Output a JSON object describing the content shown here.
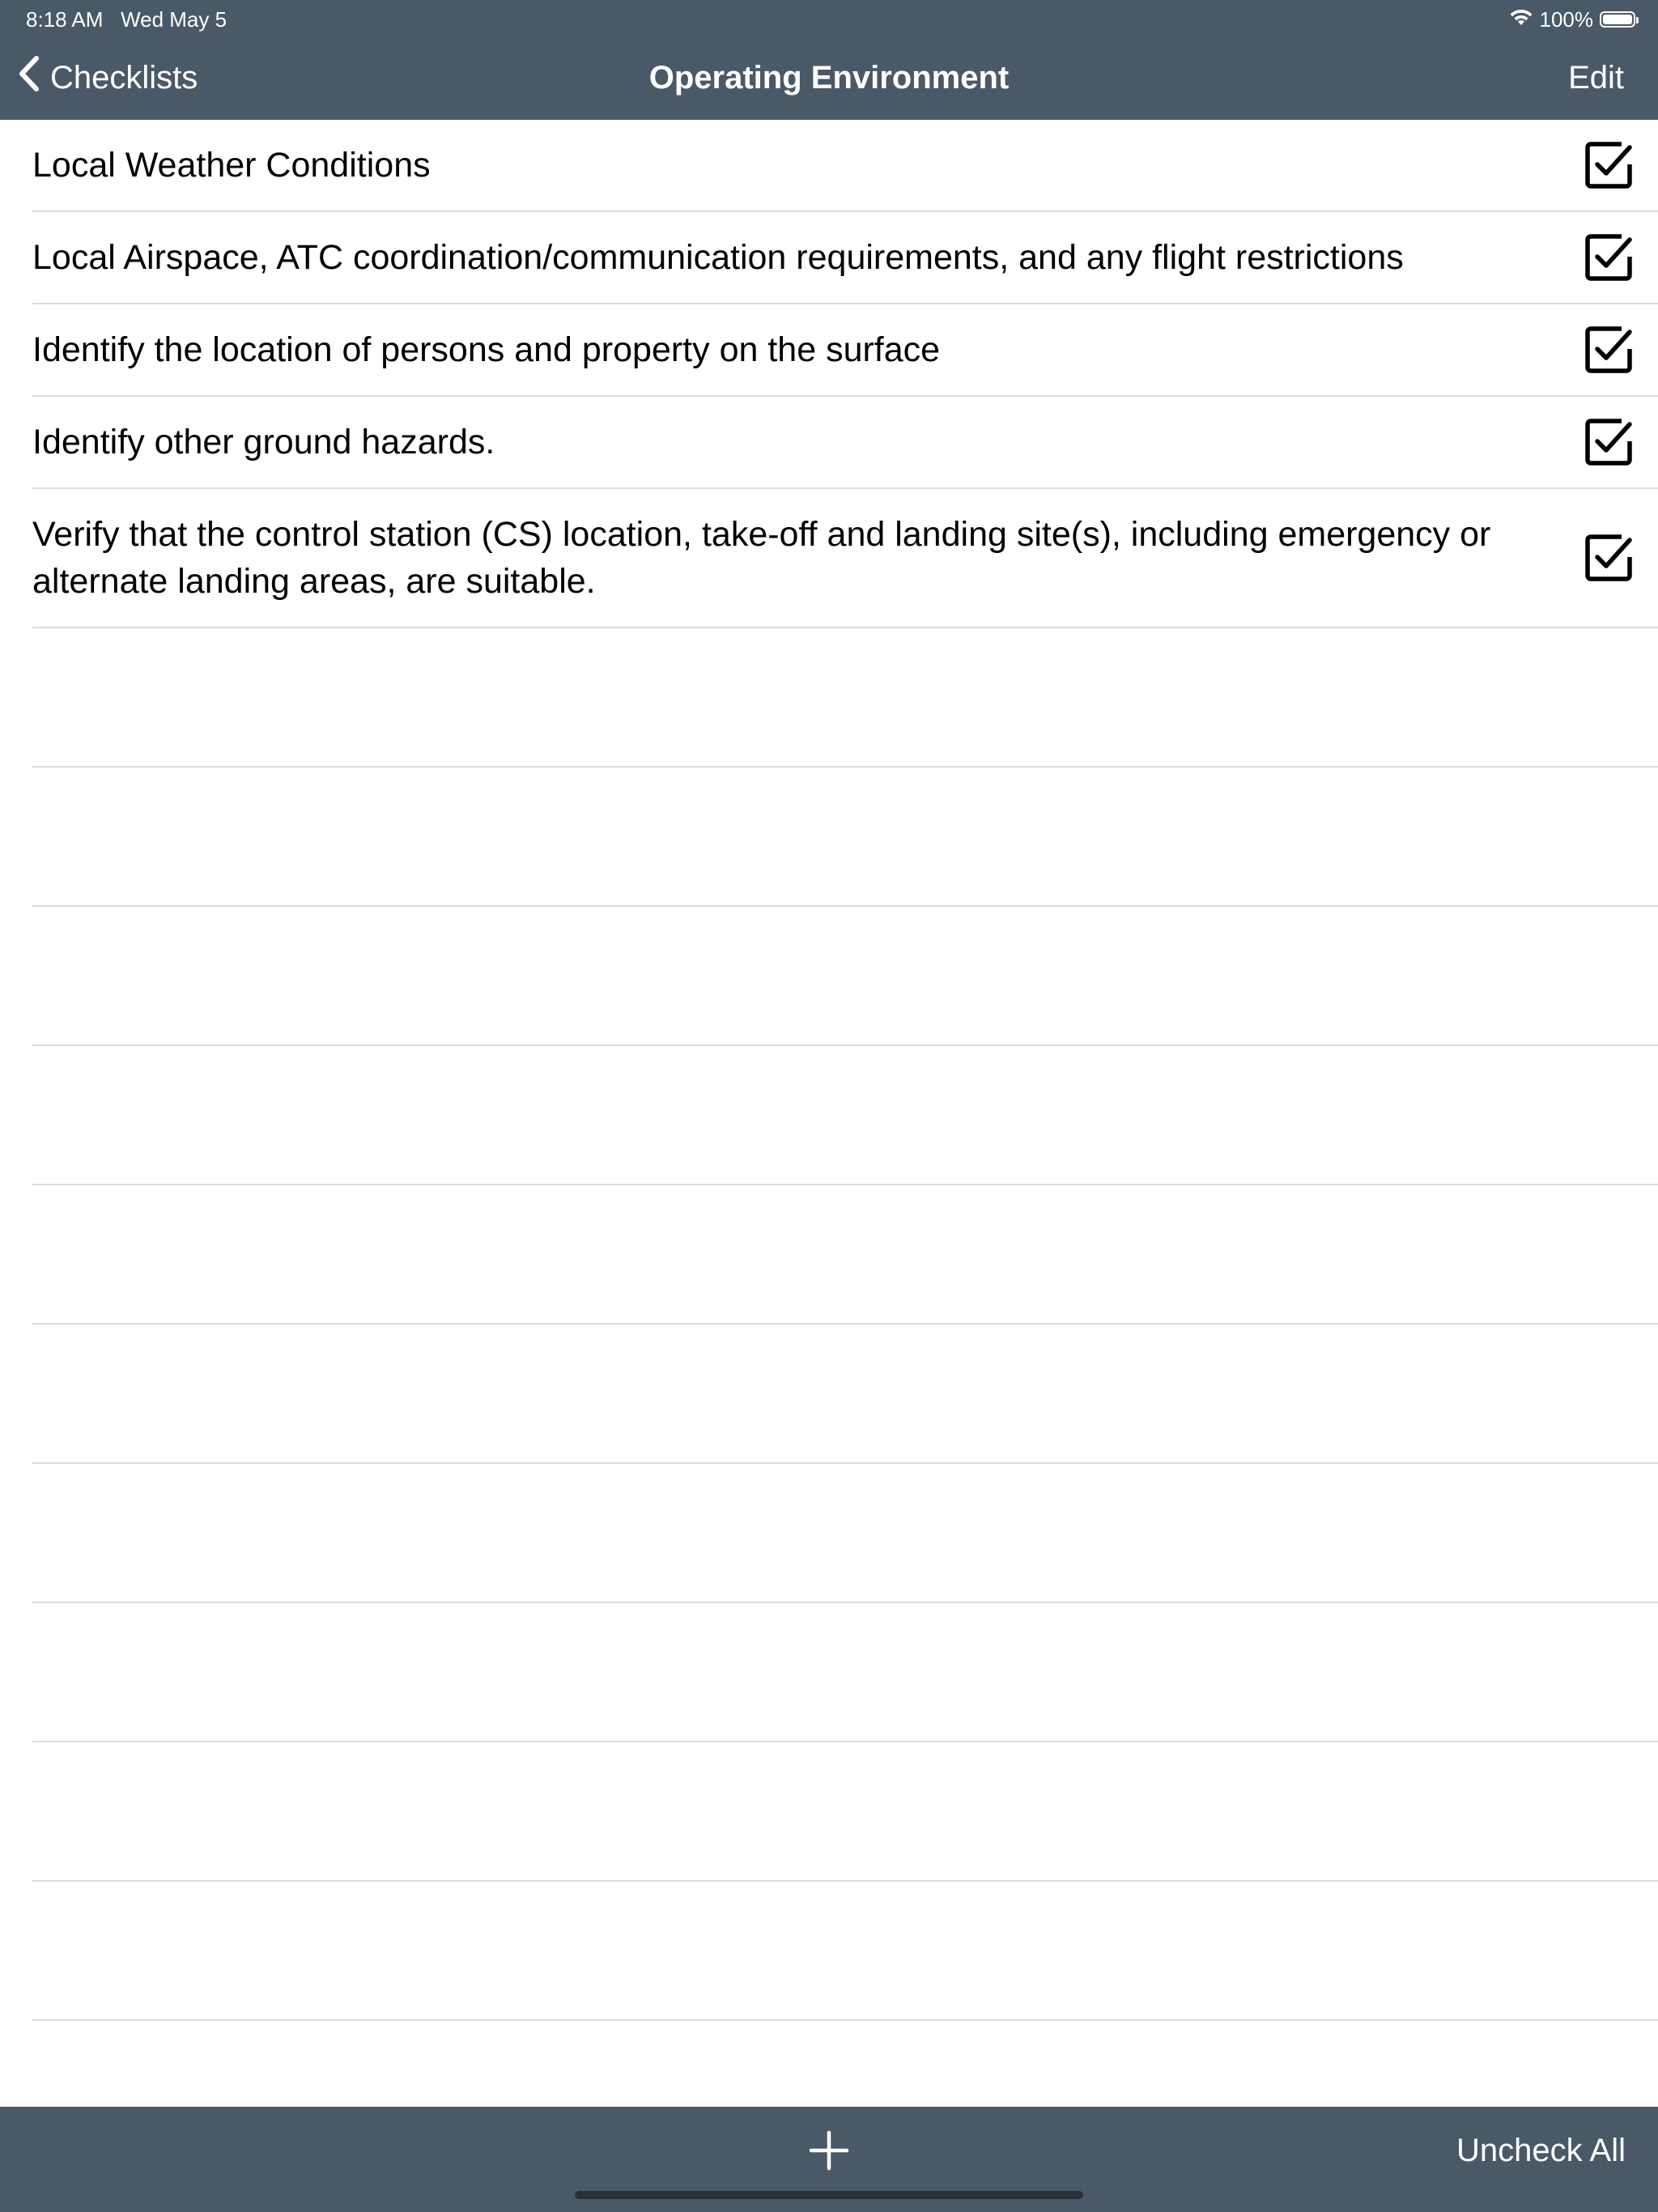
{
  "status_bar": {
    "time_date": "8:18 AM   Wed May 5",
    "battery_text": "100%",
    "battery_level": 1.0,
    "wifi_icon": "wifi-icon"
  },
  "nav": {
    "back_label": "Checklists",
    "title": "Operating Environment",
    "edit_label": "Edit"
  },
  "checklist": {
    "items": [
      {
        "label": "Local Weather Conditions",
        "checked": true
      },
      {
        "label": "Local Airspace, ATC coordination/communication requirements, and any flight restrictions",
        "checked": true
      },
      {
        "label": "Identify the location of persons and property on the surface",
        "checked": true
      },
      {
        "label": "Identify other ground hazards.",
        "checked": true
      },
      {
        "label": "Verify that the control station (CS) location, take-off and landing site(s), including emergency or alternate landing areas, are suitable.",
        "checked": true
      }
    ]
  },
  "toolbar": {
    "add_icon": "plus-icon",
    "uncheck_all_label": "Uncheck All"
  },
  "colors": {
    "bar_background": "#4a5968",
    "separator": "#dcdcde",
    "text": "#000000"
  }
}
